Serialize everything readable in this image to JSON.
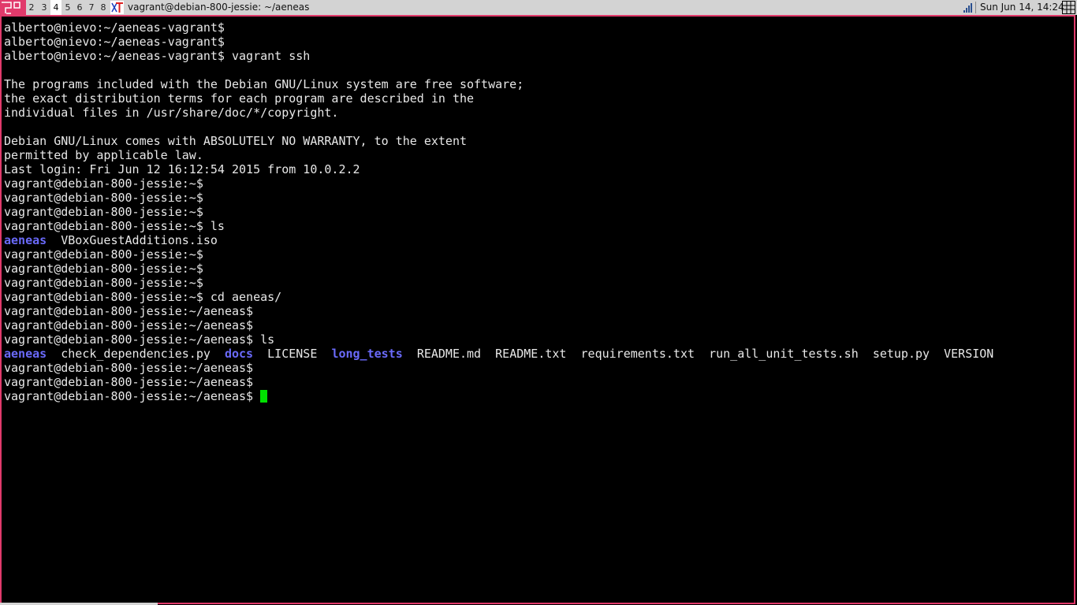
{
  "topbar": {
    "workspaces": [
      "2",
      "3",
      "4",
      "5",
      "6",
      "7",
      "8"
    ],
    "active_workspace": "4",
    "window_title": "vagrant@debian-800-jessie: ~/aeneas",
    "clock": "Sun Jun 14, 14:24",
    "layout_icon": "tiling-layout-icon",
    "app_icon": "xterm-icon",
    "tray_icons": [
      "network-signal-icon",
      "workspace-grid-icon"
    ]
  },
  "colors": {
    "accent": "#e13a6b",
    "bar_bg": "#d3d3d3",
    "terminal_bg": "#000000",
    "terminal_fg": "#e8e8e8",
    "directory": "#6a6afa",
    "cursor": "#00e000"
  },
  "terminal": {
    "lines": [
      "alberto@nievo:~/aeneas-vagrant$",
      "alberto@nievo:~/aeneas-vagrant$",
      "alberto@nievo:~/aeneas-vagrant$ vagrant ssh",
      "",
      "The programs included with the Debian GNU/Linux system are free software;",
      "the exact distribution terms for each program are described in the",
      "individual files in /usr/share/doc/*/copyright.",
      "",
      "Debian GNU/Linux comes with ABSOLUTELY NO WARRANTY, to the extent",
      "permitted by applicable law.",
      "Last login: Fri Jun 12 16:12:54 2015 from 10.0.2.2",
      "vagrant@debian-800-jessie:~$",
      "vagrant@debian-800-jessie:~$",
      "vagrant@debian-800-jessie:~$",
      "vagrant@debian-800-jessie:~$ ls",
      "__LS1__",
      "vagrant@debian-800-jessie:~$",
      "vagrant@debian-800-jessie:~$",
      "vagrant@debian-800-jessie:~$",
      "vagrant@debian-800-jessie:~$ cd aeneas/",
      "vagrant@debian-800-jessie:~/aeneas$",
      "vagrant@debian-800-jessie:~/aeneas$",
      "vagrant@debian-800-jessie:~/aeneas$ ls",
      "__LS2__",
      "vagrant@debian-800-jessie:~/aeneas$",
      "vagrant@debian-800-jessie:~/aeneas$"
    ],
    "ls_home": [
      {
        "name": "aeneas",
        "dir": true
      },
      {
        "name": "VBoxGuestAdditions.iso",
        "dir": false
      }
    ],
    "ls_aeneas": [
      {
        "name": "aeneas",
        "dir": true
      },
      {
        "name": "check_dependencies.py",
        "dir": false
      },
      {
        "name": "docs",
        "dir": true
      },
      {
        "name": "LICENSE",
        "dir": false
      },
      {
        "name": "long_tests",
        "dir": true
      },
      {
        "name": "README.md",
        "dir": false
      },
      {
        "name": "README.txt",
        "dir": false
      },
      {
        "name": "requirements.txt",
        "dir": false
      },
      {
        "name": "run_all_unit_tests.sh",
        "dir": false
      },
      {
        "name": "setup.py",
        "dir": false
      },
      {
        "name": "VERSION",
        "dir": false
      }
    ],
    "prompt": "vagrant@debian-800-jessie:~/aeneas$ "
  }
}
